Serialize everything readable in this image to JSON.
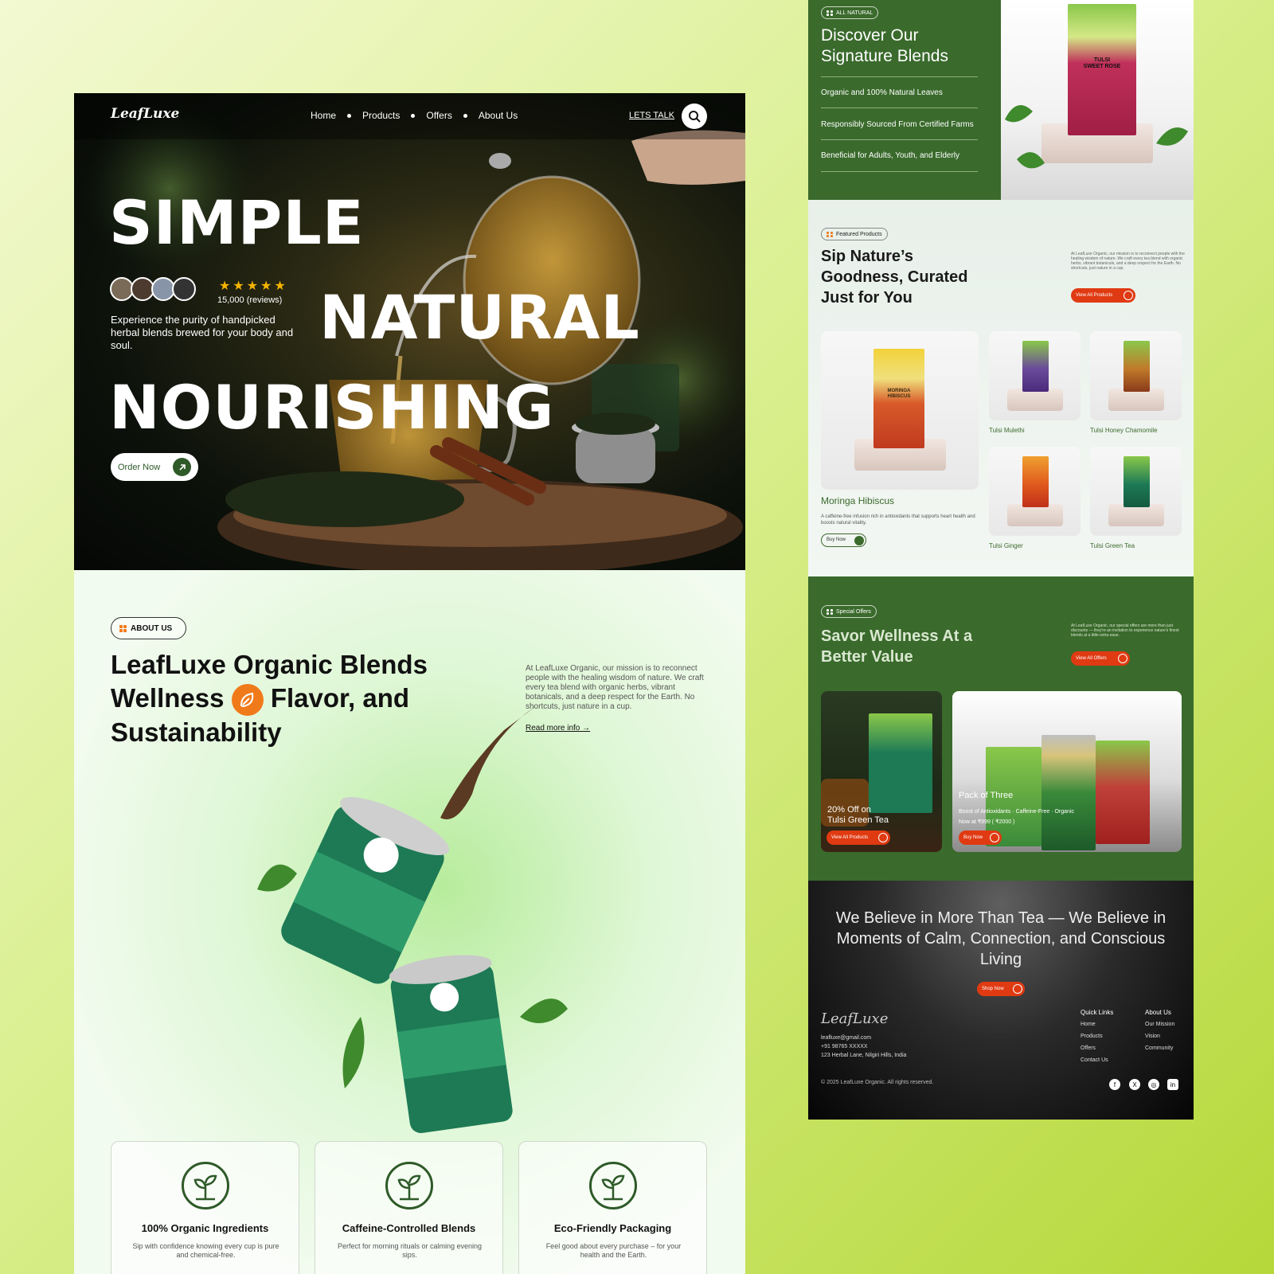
{
  "left_page": {
    "nav": {
      "logo": "LeafLuxe",
      "links": [
        "Home",
        "Products",
        "Offers",
        "About Us"
      ],
      "cta": "LETS TALK"
    },
    "hero": {
      "word1": "SIMPLE",
      "word2": "NATURAL",
      "word3": "NOURISHING",
      "stars": "★★★★★",
      "reviews": "15,000 (reviews)",
      "description": "Experience the purity of handpicked herbal blends brewed for your body and soul.",
      "order_label": "Order Now"
    },
    "about": {
      "badge": "ABOUT US",
      "title_line1": "LeafLuxe Organic Blends",
      "title_line2a": "Wellness",
      "title_line2b": "Flavor, and",
      "title_line3": "Sustainability",
      "description": "At LeafLuxe Organic, our mission is to reconnect people with the healing wisdom of nature. We craft every tea blend with organic herbs, vibrant botanicals, and a deep respect for the Earth. No shortcuts, just nature in a cup.",
      "read_more": "Read more info"
    },
    "features": [
      {
        "title": "100% Organic Ingredients",
        "desc": "Sip with confidence knowing every cup is pure and chemical-free."
      },
      {
        "title": "Caffeine-Controlled Blends",
        "desc": "Perfect for morning rituals or calming evening sips."
      },
      {
        "title": "Eco-Friendly Packaging",
        "desc": "Feel good about every purchase – for your health and the Earth."
      }
    ]
  },
  "right_page": {
    "signature": {
      "badge": "ALL NATURAL",
      "title_line1": "Discover Our",
      "title_line2": "Signature Blends",
      "items": [
        "Organic and 100% Natural Leaves",
        "Responsibly Sourced From Certified Farms",
        "Beneficial for Adults, Youth, and Elderly"
      ],
      "box_label_line1": "TULSI",
      "box_label_line2": "SWEET ROSE"
    },
    "featured": {
      "badge": "Featured Products",
      "title_line1": "Sip Nature’s",
      "title_line2": "Goodness, Curated",
      "title_line3": "Just for You",
      "description": "At LeafLuxe Organic, our mission is to reconnect people with the healing wisdom of nature. We craft every tea blend with organic herbs, vibrant botanicals, and a deep respect for the Earth. No shortcuts, just nature in a cup.",
      "cta": "View All Products",
      "main_product": {
        "name": "Moringa Hibiscus",
        "desc": "A caffeine-free infusion rich in antioxidants that supports heart health and boosts natural vitality.",
        "cta": "Buy Now",
        "box_label_line1": "MORINGA",
        "box_label_line2": "HIBISCUS"
      },
      "products": [
        "Tulsi Mulethi",
        "Tulsi Honey Chamomile",
        "Tulsi Ginger",
        "Tulsi Green Tea"
      ]
    },
    "offers": {
      "badge": "Special Offers",
      "title_line1": "Savor Wellness At a",
      "title_line2": "Better Value",
      "description": "At LeafLuxe Organic, our special offers are more than just discounts — they're an invitation to experience nature's finest blends at a little extra ease.",
      "cta": "View All Offers",
      "offer1": {
        "line1": "20% Off on",
        "line2": "Tulsi Green Tea",
        "cta": "View All Products"
      },
      "offer2": {
        "title": "Pack of Three",
        "line1": "Boost of Antioxidants · Caffeine-Free · Organic",
        "line2": "Now at ₹999 ( ₹2000 )",
        "cta": "Buy Now"
      }
    },
    "footer": {
      "quote": "We Believe in More Than Tea — We Believe in Moments of Calm, Connection, and Conscious Living",
      "cta": "Shop Now",
      "logo": "LeafLuxe",
      "email": "leafluxe@gmail.com",
      "phone": "+91 98765 XXXXX",
      "address": "123 Herbal Lane, Nilgiri Hills, India",
      "quick_links_title": "Quick Links",
      "quick_links": [
        "Home",
        "Products",
        "Offers",
        "Contact Us"
      ],
      "about_title": "About Us",
      "about_links": [
        "Our Mission",
        "Vision",
        "Community"
      ],
      "copyright": "© 2025 LeafLuxe Organic. All rights reserved.",
      "social_icons": [
        "facebook-icon",
        "x-icon",
        "instagram-icon",
        "linkedin-icon"
      ]
    }
  },
  "colors": {
    "brand_green": "#3a6a2c",
    "accent_orange": "#f07a1a",
    "cta_red": "#e03a12",
    "star_gold": "#f6b400"
  }
}
